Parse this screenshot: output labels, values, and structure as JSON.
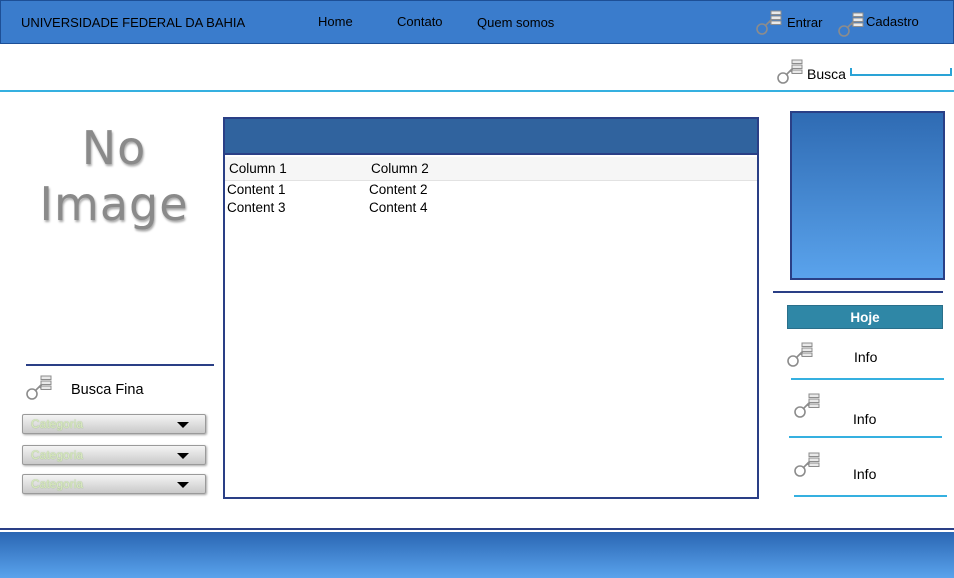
{
  "header": {
    "title": "UNIVERSIDADE FEDERAL DA BAHIA",
    "nav": [
      "Home",
      "Contato",
      "Quem somos"
    ],
    "entrar_label": "Entrar",
    "cadastro_label": "Cadastro"
  },
  "search": {
    "label": "Busca",
    "value": ""
  },
  "left": {
    "placeholder_line1": "No",
    "placeholder_line2": "Image",
    "busca_fina_label": "Busca Fina",
    "dropdowns": [
      "Categoria",
      "Categoria",
      "Categoria"
    ]
  },
  "table": {
    "columns": [
      "Column 1",
      "Column 2"
    ],
    "rows": [
      [
        "Content 1",
        "Content 2"
      ],
      [
        "Content 3",
        "Content 4"
      ]
    ]
  },
  "right": {
    "hoje_label": "Hoje",
    "info_items": [
      "Info",
      "Info",
      "Info"
    ]
  },
  "icons": {
    "key_list": "key-list-icon",
    "dropdown_arrow": "chevron-down-icon"
  },
  "colors": {
    "topbar": "#3a7ccc",
    "accent_rule": "#35b0e0",
    "panel_header": "#30639e",
    "hoje": "#2f87a6",
    "border_navy": "#2a3f86"
  }
}
